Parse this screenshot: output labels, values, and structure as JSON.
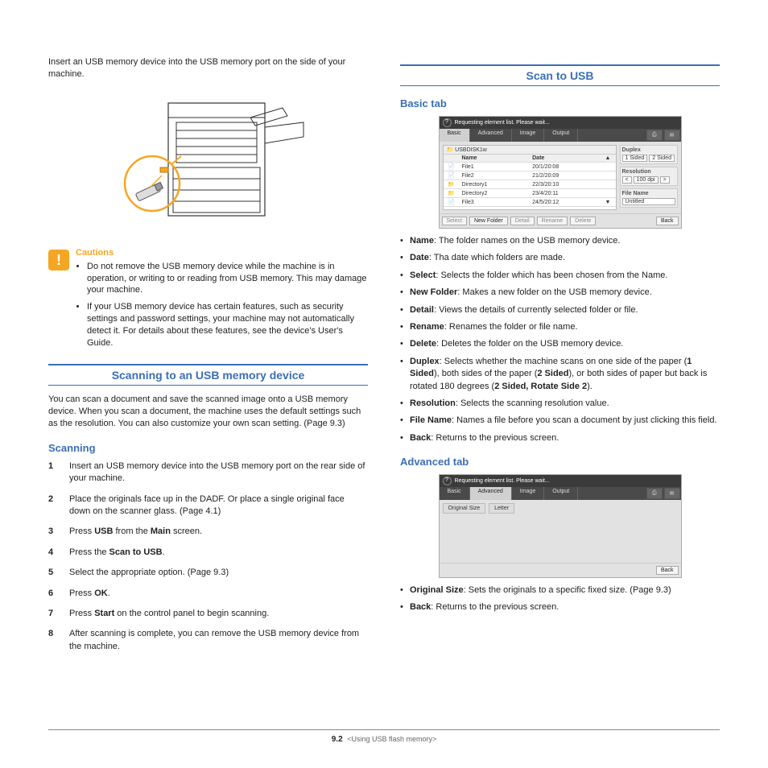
{
  "left": {
    "intro": "Insert an USB memory device into the USB memory port on the side of your machine.",
    "cautions_title": "Cautions",
    "cautions": [
      "Do not remove the USB memory device while the machine is in operation, or writing to or reading from USB memory. This may damage your machine.",
      "If your USB memory device has certain features, such as security settings and password settings, your machine may not automatically detect it. For details about these features, see the device's User's Guide."
    ],
    "section_heading": "Scanning to an USB memory device",
    "section_intro": "You can scan a document and save the scanned image onto a USB memory device. When you scan a document, the machine uses the default settings such as the resolution. You can also customize your own scan setting. (Page 9.3)",
    "scanning_heading": "Scanning",
    "steps": [
      "Insert an USB memory device into the USB memory port on the rear side of your machine.",
      "Place the originals face up in the DADF. Or place a single original face down on the scanner glass. (Page 4.1)",
      "Press <b>USB</b> from the <b>Main</b> screen.",
      "Press the <b>Scan to USB</b>.",
      "Select the appropriate option. (Page 9.3)",
      "Press <b>OK</b>.",
      "Press <b>Start</b> on the control panel to begin scanning.",
      "After scanning is complete, you can remove the USB memory device from the machine."
    ]
  },
  "right": {
    "section_heading": "Scan to USB",
    "basic_heading": "Basic tab",
    "basic_shot": {
      "title": "Requesting element list. Please wait...",
      "tabs": [
        "Basic",
        "Advanced",
        "Image",
        "Output"
      ],
      "path": "USBDISK1w",
      "cols": [
        "Name",
        "Date"
      ],
      "rows": [
        {
          "icon": "📄",
          "name": "File1",
          "date": "20/1/20:08"
        },
        {
          "icon": "📄",
          "name": "File2",
          "date": "21/2/20:09"
        },
        {
          "icon": "📁",
          "name": "Directory1",
          "date": "22/3/20:10"
        },
        {
          "icon": "📁",
          "name": "Directory2",
          "date": "23/4/20:11"
        },
        {
          "icon": "📄",
          "name": "File3",
          "date": "24/5/20:12"
        }
      ],
      "side": {
        "duplex_label": "Duplex",
        "duplex_opts": [
          "1 Sided",
          "2 Sided"
        ],
        "res_label": "Resolution",
        "res_val": "100 dpi",
        "fname_label": "File Name",
        "fname_val": "Untitled"
      },
      "footer": [
        "Select",
        "New Folder",
        "Detail",
        "Rename",
        "Delete",
        "Back"
      ]
    },
    "basic_defs": [
      {
        "term": "Name",
        "desc": ": The folder names on the USB memory device."
      },
      {
        "term": "Date",
        "desc": ": Tha date which folders are made."
      },
      {
        "term": "Select",
        "desc": ": Selects the folder which has been chosen from the Name."
      },
      {
        "term": "New Folder",
        "desc": ": Makes a new folder on the USB memory device."
      },
      {
        "term": "Detail",
        "desc": ": Views the details of currently selected folder or file."
      },
      {
        "term": "Rename",
        "desc": ": Renames the folder or file name."
      },
      {
        "term": "Delete",
        "desc": ": Deletes the folder on the USB memory device."
      },
      {
        "term": "Duplex",
        "desc": ": Selects whether the machine scans on one side of the paper (<b>1 Sided</b>), both sides of the paper (<b>2 Sided</b>), or both sides of paper but back is rotated 180 degrees (<b>2 Sided, Rotate Side 2</b>)."
      },
      {
        "term": "Resolution",
        "desc": ": Selects the scanning resolution value."
      },
      {
        "term": "File Name",
        "desc": ": Names a file before you scan a document by just clicking this field."
      },
      {
        "term": "Back",
        "desc": ": Returns to the previous screen."
      }
    ],
    "advanced_heading": "Advanced tab",
    "adv_shot": {
      "title": "Requesting element list. Please wait...",
      "tabs": [
        "Basic",
        "Advanced",
        "Image",
        "Output"
      ],
      "row_btns": [
        "Original Size",
        "Letter"
      ],
      "back": "Back"
    },
    "advanced_defs": [
      {
        "term": "Original Size",
        "desc": ": Sets the originals to a specific fixed size. (Page 9.3)"
      },
      {
        "term": "Back",
        "desc": ": Returns to the previous screen."
      }
    ]
  },
  "footer": {
    "page": "9.2",
    "chapter": "<Using USB flash memory>"
  }
}
